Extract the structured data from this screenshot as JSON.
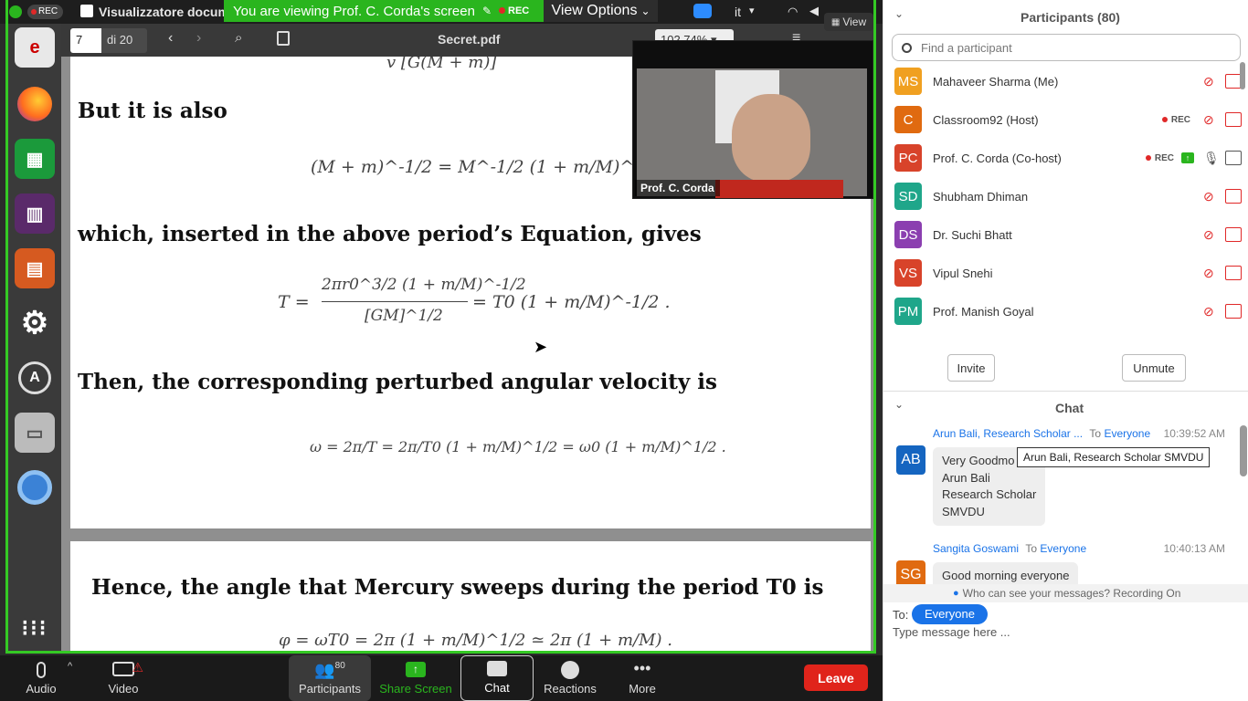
{
  "os": {
    "app_title": "Visualizzatore docum",
    "rec_badge": "REC",
    "lang": "it"
  },
  "share_banner": {
    "text": "You are viewing Prof. C. Corda's screen",
    "rec": "REC"
  },
  "view_options": {
    "label": "View Options"
  },
  "view_button": {
    "label": "View"
  },
  "viewer": {
    "page_input": "7",
    "page_total": "di 20",
    "filename": "Secret.pdf",
    "zoom": "102,74%"
  },
  "document": {
    "eq_top": "v      [G(M + m)]",
    "line1": "But it is also",
    "eq1": "(M + m)^-1/2 = M^-1/2 (1 + m/M)^-1/2 ,",
    "line2": "which, inserted in the above period’s Equation, gives",
    "eq2_lhs": "T =",
    "eq2_num": "2πr0^3/2 (1 + m/M)^-1/2",
    "eq2_den": "[GM]^1/2",
    "eq2_rhs": "= T0 (1 + m/M)^-1/2 .",
    "line3": "Then, the corresponding perturbed angular velocity is",
    "eq3": "ω = 2π/T = 2π/T0 (1 + m/M)^1/2 = ω0 (1 + m/M)^1/2 .",
    "line4": "Hence, the angle that Mercury sweeps during the period T0 is",
    "eq4": "φ = ωT0 = 2π (1 + m/M)^1/2 ≃ 2π (1 + m/M) ."
  },
  "video": {
    "name": "Prof. C. Corda"
  },
  "toolbar": {
    "audio": "Audio",
    "video": "Video",
    "participants": "Participants",
    "participants_count": "80",
    "share": "Share Screen",
    "chat": "Chat",
    "reactions": "Reactions",
    "more": "More",
    "leave": "Leave"
  },
  "participants": {
    "title": "Participants (80)",
    "search_placeholder": "Find a participant",
    "items": [
      {
        "initials": "MS",
        "name": "Mahaveer Sharma (Me)",
        "color": "#f0a020"
      },
      {
        "initials": "C",
        "name": "Classroom92 (Host)",
        "color": "#e06a10",
        "rec": "REC"
      },
      {
        "initials": "PC",
        "name": "Prof. C. Corda (Co-host)",
        "color": "#d8432a",
        "rec": "REC"
      },
      {
        "initials": "SD",
        "name": "Shubham Dhiman",
        "color": "#1fa68a"
      },
      {
        "initials": "DS",
        "name": "Dr. Suchi Bhatt",
        "color": "#8b3fb0"
      },
      {
        "initials": "VS",
        "name": "Vipul Snehi",
        "color": "#d8432a"
      },
      {
        "initials": "PM",
        "name": "Prof. Manish Goyal",
        "color": "#1fa68a"
      }
    ],
    "invite": "Invite",
    "unmute": "Unmute"
  },
  "chat": {
    "title": "Chat",
    "messages": [
      {
        "initials": "AB",
        "sender": "Arun Bali, Research Scholar ...",
        "to_label": "To",
        "to": "Everyone",
        "time": "10:39:52 AM",
        "lines": [
          "Very Goodmo",
          "Arun Bali",
          "Research Scholar",
          "SMVDU"
        ],
        "color": "#1565c0"
      },
      {
        "initials": "SG",
        "sender": "Sangita Goswami",
        "to_label": "To",
        "to": "Everyone",
        "time": "10:40:13 AM",
        "lines": [
          "Good morning everyone"
        ],
        "color": "#e06a10"
      }
    ],
    "tooltip": "Arun Bali, Research Scholar SMVDU",
    "visibility": "Who can see your messages? Recording On",
    "to_label": "To:",
    "to_value": "Everyone",
    "input_placeholder": "Type message here ..."
  }
}
